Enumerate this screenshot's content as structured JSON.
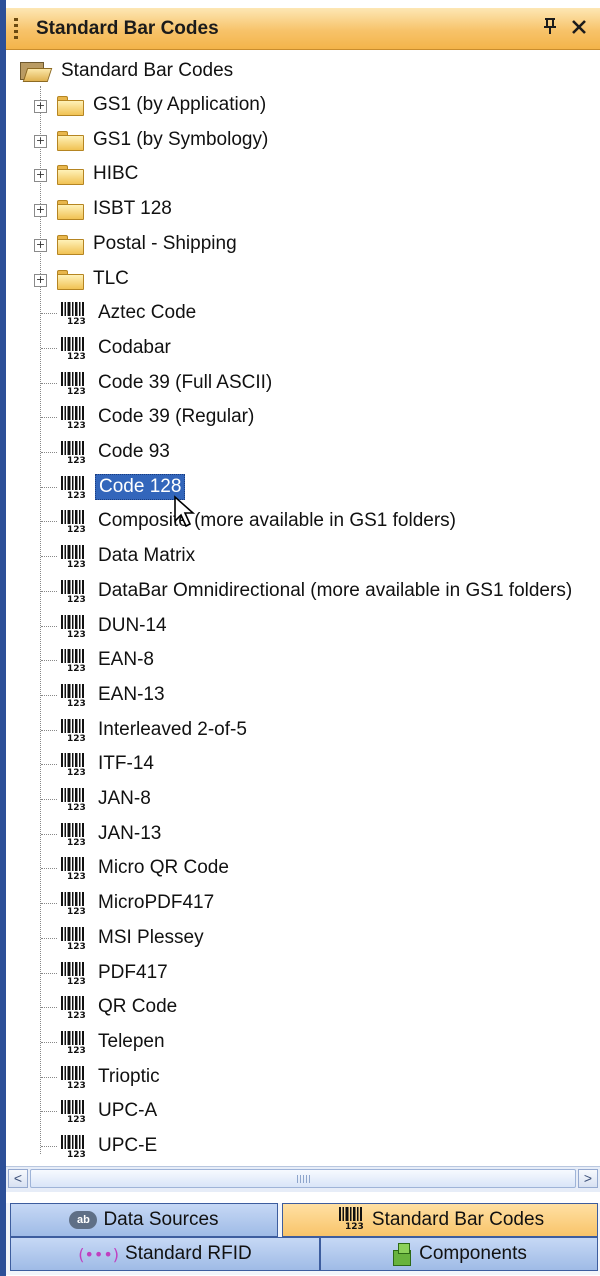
{
  "panel": {
    "title": "Standard Bar Codes",
    "pin_glyph": "p",
    "close_glyph": "×",
    "pin_icon": "pin-icon",
    "close_icon": "close-icon"
  },
  "tree": {
    "root": "Standard Bar Codes",
    "folders": [
      "GS1 (by Application)",
      "GS1 (by Symbology)",
      "HIBC",
      "ISBT 128",
      "Postal - Shipping",
      "TLC"
    ],
    "items": [
      "Aztec Code",
      "Codabar",
      "Code 39 (Full ASCII)",
      "Code 39 (Regular)",
      "Code 93",
      "Code 128",
      "Composite (more available in GS1 folders)",
      "Data Matrix",
      "DataBar Omnidirectional (more available in GS1 folders)",
      "DUN-14",
      "EAN-8",
      "EAN-13",
      "Interleaved 2-of-5",
      "ITF-14",
      "JAN-8",
      "JAN-13",
      "Micro QR Code",
      "MicroPDF417",
      "MSI Plessey",
      "PDF417",
      "QR Code",
      "Telepen",
      "Trioptic",
      "UPC-A",
      "UPC-E"
    ],
    "selected_item": "Code 128",
    "expander_glyph": "+"
  },
  "scrollbar": {
    "left_arrow": "<",
    "right_arrow": ">"
  },
  "tabs": {
    "data_sources": "Data Sources",
    "standard_bar_codes": "Standard Bar Codes",
    "standard_rfid": "Standard RFID",
    "components": "Components",
    "ab_badge": "ab",
    "rfid_glyph": "(•••)"
  },
  "colors": {
    "accent": "#2c4f98",
    "title_gradient": "#f7c36a",
    "selection": "#3366bb",
    "active_tab": "#f8c46a",
    "inactive_tab": "#9fbbe6"
  }
}
